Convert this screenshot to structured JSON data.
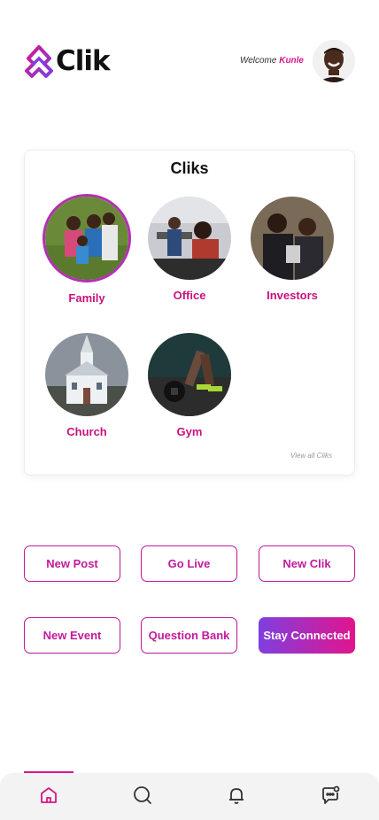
{
  "header": {
    "app_name": "Clik",
    "welcome_prefix": "Welcome",
    "user_name": "Kunle"
  },
  "cliks": {
    "title": "Cliks",
    "items": [
      {
        "label": "Family"
      },
      {
        "label": "Office"
      },
      {
        "label": "Investors"
      },
      {
        "label": "Church"
      },
      {
        "label": "Gym"
      }
    ],
    "view_all": "View all Cliks"
  },
  "actions": {
    "new_post": "New Post",
    "go_live": "Go Live",
    "new_clik": "New Clik",
    "new_event": "New Event",
    "question_bank": "Question Bank",
    "stay_connected": "Stay Connected"
  },
  "nav": {
    "items": [
      "home-icon",
      "search-icon",
      "bell-icon",
      "chat-icon"
    ],
    "active": "home-icon"
  },
  "colors": {
    "accent": "#d6168b",
    "purple": "#7f3fe0"
  }
}
